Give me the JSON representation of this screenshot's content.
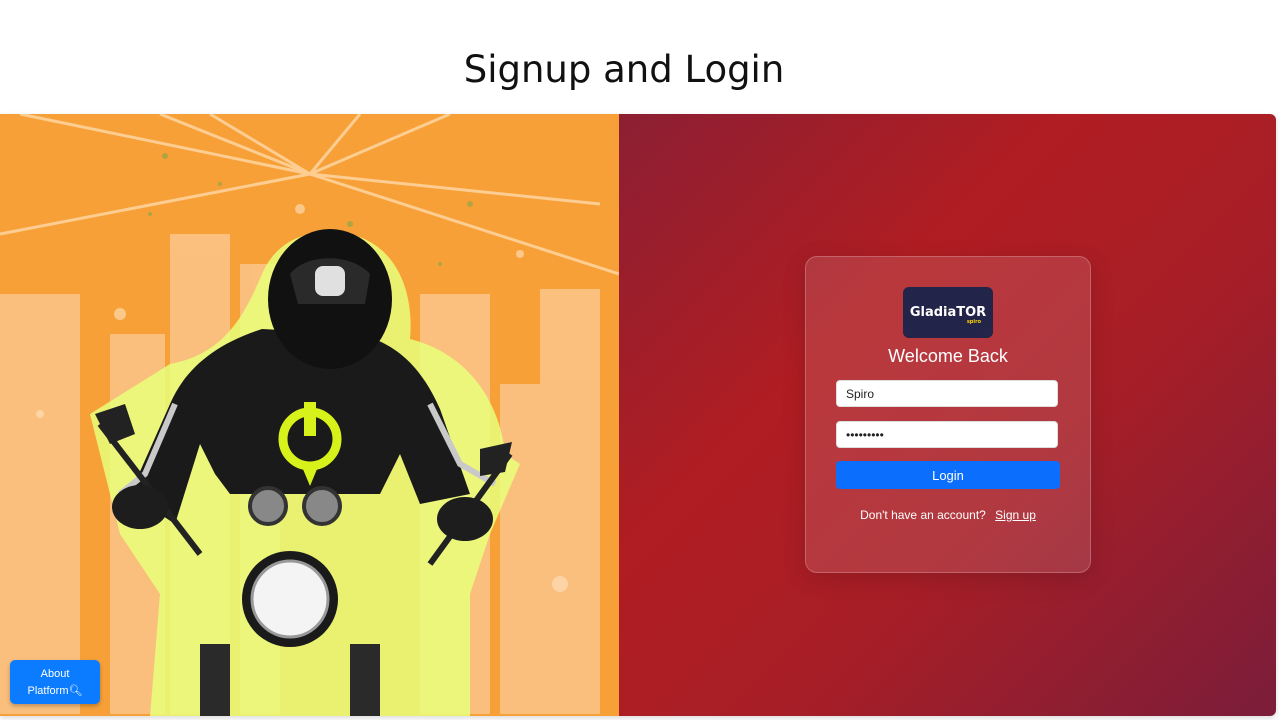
{
  "page": {
    "title": "Signup and Login"
  },
  "logo": {
    "text": "GladiaTOR",
    "sub": "spiro"
  },
  "login": {
    "heading": "Welcome Back",
    "username_value": "Spiro",
    "password_value": "•••••••••",
    "submit_label": "Login",
    "signup_prompt": "Don't have an account?",
    "signup_link": "Sign up"
  },
  "about": {
    "line1": "About",
    "line2": "Platform"
  },
  "colors": {
    "hero_bg": "#f7a038",
    "panel_gradient_start": "#8c1f33",
    "panel_gradient_mid": "#b01d22",
    "panel_gradient_end": "#7b1d3a",
    "primary_button": "#0b6efd",
    "logo_bg": "#23244a",
    "emblem": "#d7f21a"
  },
  "icons": {
    "about_icon": "magnifier-icon"
  }
}
